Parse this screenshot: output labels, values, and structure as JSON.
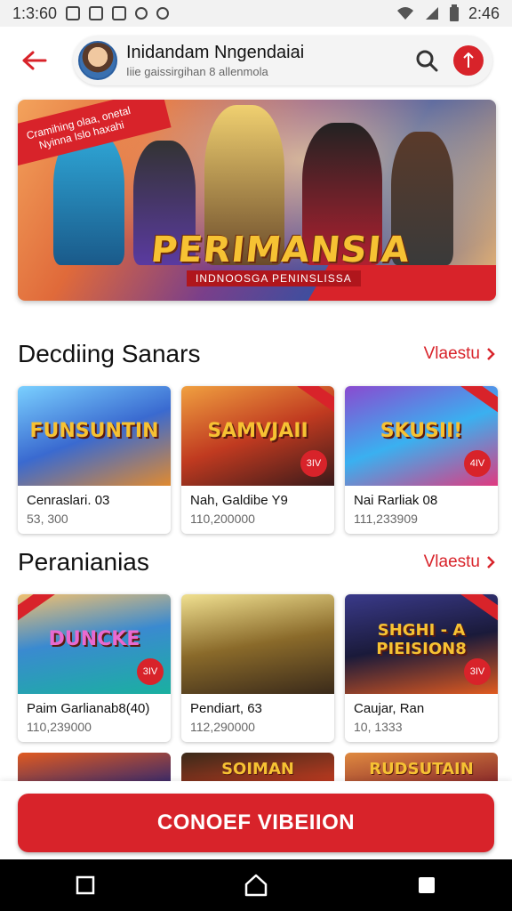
{
  "status_bar": {
    "time_left": "1:3:60",
    "time_right": "2:46"
  },
  "header": {
    "back_icon": "arrow-left-icon",
    "profile_name": "Inidandam Nngendaiai",
    "profile_sub": "Iiie gaissirgihan 8 allenmola",
    "search_icon": "search-icon",
    "brand_icon": "brand-icon"
  },
  "hero": {
    "ribbon_text": "Cramihing olaa, onetal Nyinna Islo haxahi",
    "title": "PERIMANSIA",
    "subtitle": "INDNOOSGA PENINSLISSA"
  },
  "sections": [
    {
      "title": "Decdiing Sanars",
      "link": "Vlaestu",
      "cards": [
        {
          "art": "FUNSUNTIN",
          "badge": "",
          "title": "Cenraslari. 03",
          "meta": "53, 300"
        },
        {
          "art": "SAMVJAII",
          "badge": "3IV",
          "title": "Nah, Galdibe Y9",
          "meta": "110,200000"
        },
        {
          "art": "SKUSII!",
          "badge": "4IV",
          "title": "Nai Rarliak 08",
          "meta": "111,233909"
        }
      ]
    },
    {
      "title": "Peranianias",
      "link": "Vlaestu",
      "cards": [
        {
          "art": "DUNCKE",
          "badge": "3IV",
          "title": "Paim Garlianab8(40)",
          "meta": "110,239000"
        },
        {
          "art": "",
          "badge": "",
          "title": "Pendiart, 63",
          "meta": "112,290000"
        },
        {
          "art": "SHGHI - A PIEISION8",
          "badge": "3IV",
          "title": "Caujar, Ran",
          "meta": "10, 1333"
        }
      ]
    }
  ],
  "partial_cards": [
    "",
    "SOIMAN",
    "RUDSUTAIN"
  ],
  "cta_label": "CONOEF VIBEIION",
  "nav": {
    "recents": "recents-icon",
    "home": "home-icon",
    "back": "square-icon"
  },
  "colors": {
    "accent": "#d8232a"
  }
}
